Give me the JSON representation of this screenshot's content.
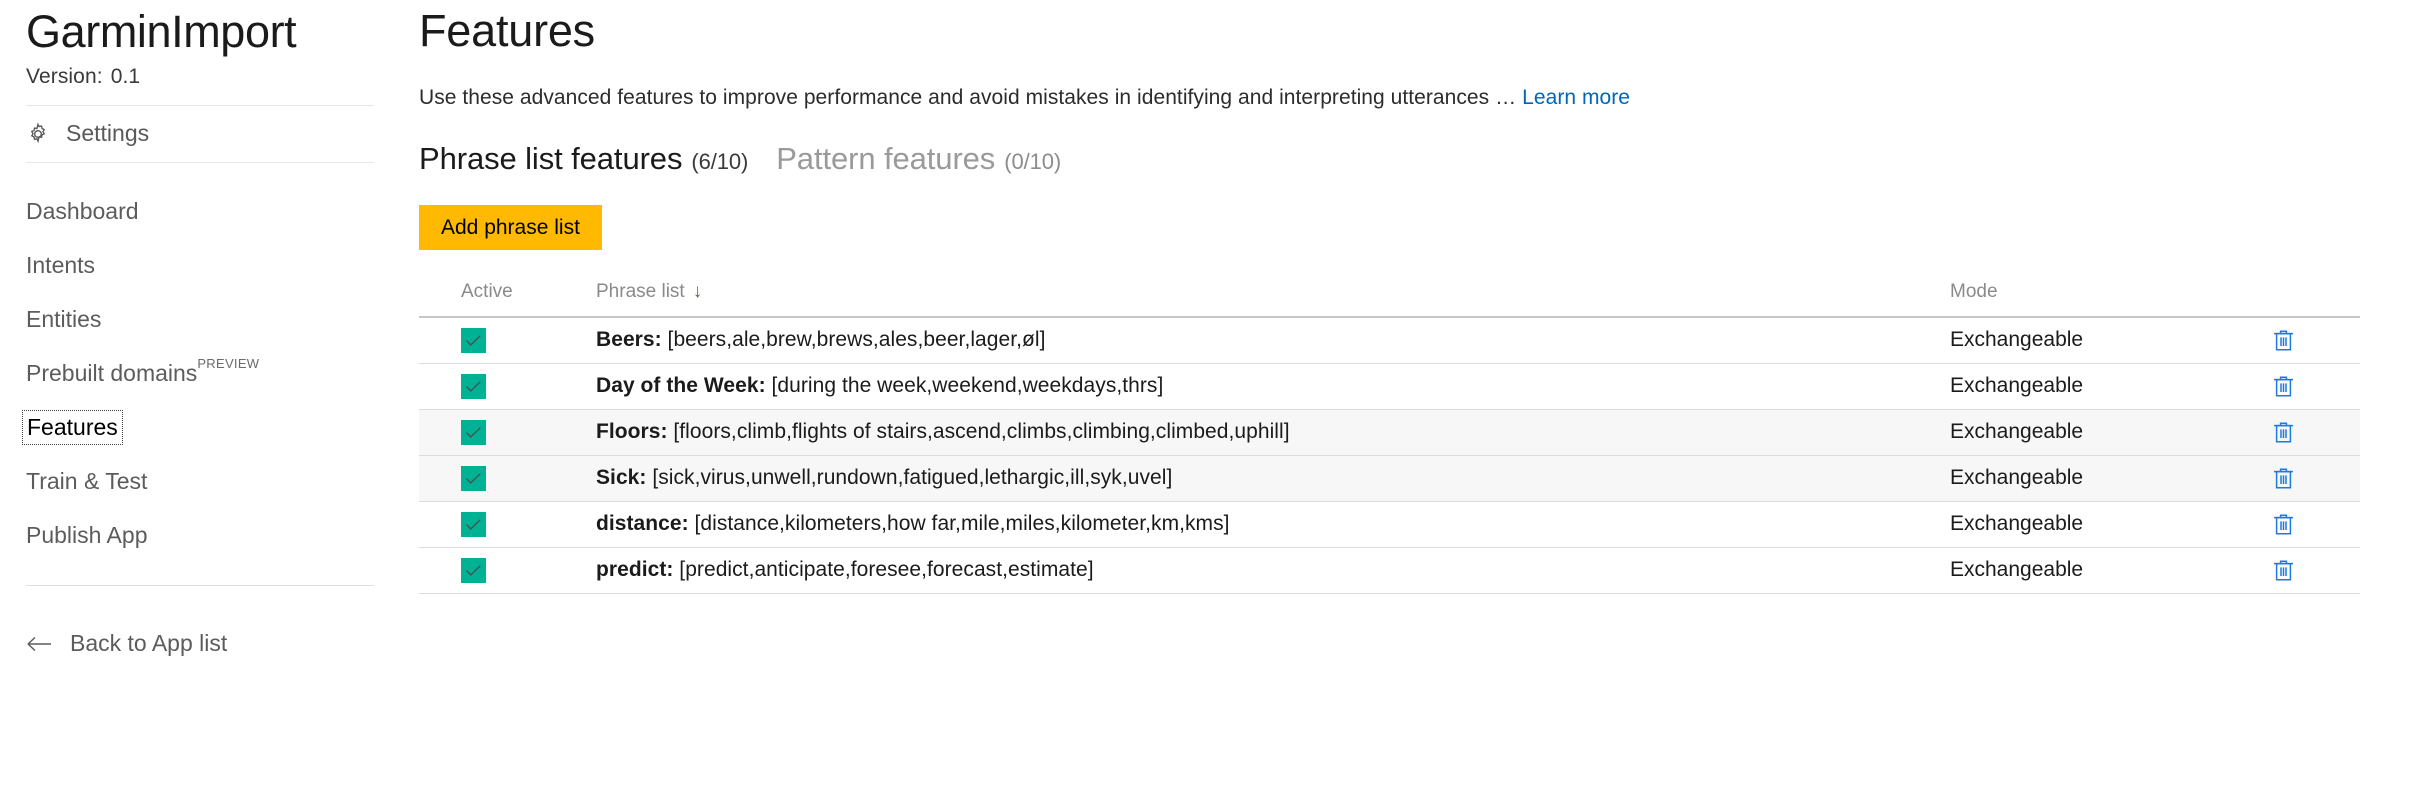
{
  "sidebar": {
    "app_title": "GarminImport",
    "version_label": "Version:",
    "version_value": "0.1",
    "settings_label": "Settings",
    "settings_icon": "gear-icon",
    "nav_items": [
      {
        "label": "Dashboard",
        "active": false,
        "badge": ""
      },
      {
        "label": "Intents",
        "active": false,
        "badge": ""
      },
      {
        "label": "Entities",
        "active": false,
        "badge": ""
      },
      {
        "label": "Prebuilt domains",
        "active": false,
        "badge": "PREVIEW"
      },
      {
        "label": "Features",
        "active": true,
        "badge": ""
      },
      {
        "label": "Train & Test",
        "active": false,
        "badge": ""
      },
      {
        "label": "Publish App",
        "active": false,
        "badge": ""
      }
    ],
    "back_label": "Back to App list",
    "back_icon": "arrow-left-icon"
  },
  "main": {
    "page_title": "Features",
    "description": "Use these advanced features to improve performance and avoid mistakes in identifying and interpreting utterances …",
    "learn_more": "Learn more",
    "tabs": [
      {
        "label": "Phrase list features",
        "count": "(6/10)",
        "active": true
      },
      {
        "label": "Pattern features",
        "count": "(0/10)",
        "active": false
      }
    ],
    "add_button": "Add phrase list",
    "table": {
      "columns": {
        "active": "Active",
        "phrase_list": "Phrase list",
        "sort_arrow": "↓",
        "mode": "Mode",
        "delete": ""
      },
      "rows": [
        {
          "active": true,
          "name": "Beers:",
          "values": " [beers,ale,brew,brews,ales,beer,lager,øl]",
          "mode": "Exchangeable",
          "shaded": false
        },
        {
          "active": true,
          "name": "Day of the Week:",
          "values": " [during the week,weekend,weekdays,thrs]",
          "mode": "Exchangeable",
          "shaded": false
        },
        {
          "active": true,
          "name": "Floors:",
          "values": " [floors,climb,flights of stairs,ascend,climbs,climbing,climbed,uphill]",
          "mode": "Exchangeable",
          "shaded": true
        },
        {
          "active": true,
          "name": "Sick:",
          "values": " [sick,virus,unwell,rundown,fatigued,lethargic,ill,syk,uvel]",
          "mode": "Exchangeable",
          "shaded": true
        },
        {
          "active": true,
          "name": "distance:",
          "values": " [distance,kilometers,how far,mile,miles,kilometer,km,kms]",
          "mode": "Exchangeable",
          "shaded": false
        },
        {
          "active": true,
          "name": "predict:",
          "values": " [predict,anticipate,foresee,forecast,estimate]",
          "mode": "Exchangeable",
          "shaded": false
        }
      ]
    }
  },
  "colors": {
    "accent_yellow": "#ffb900",
    "checkbox_teal": "#00b294",
    "link_blue": "#0067b8",
    "trash_blue": "#1f7ae0"
  }
}
